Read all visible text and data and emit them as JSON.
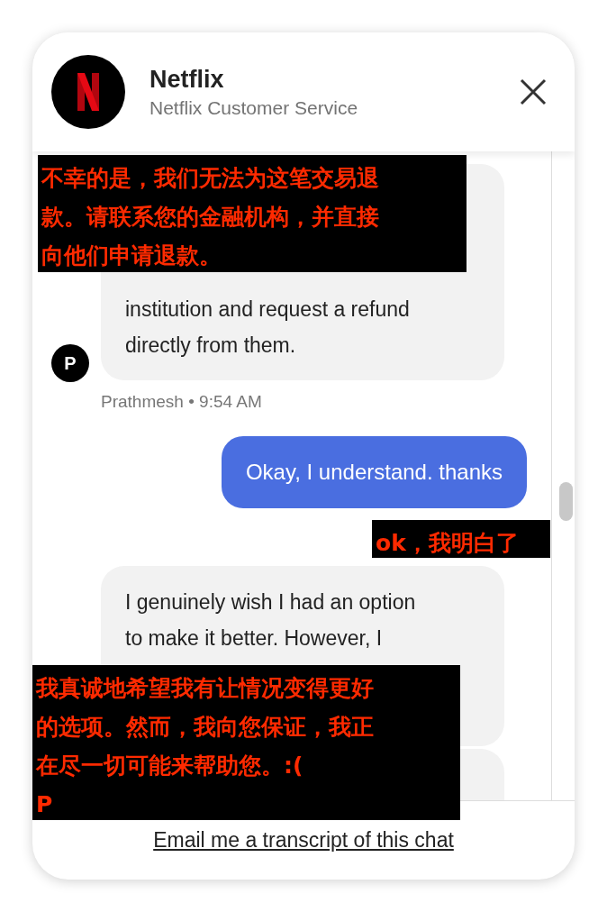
{
  "header": {
    "title": "Netflix",
    "subtitle": "Netflix Customer Service"
  },
  "messages": [
    {
      "kind": "agent",
      "lines": [
        "institution and request a refund",
        "directly from them."
      ],
      "avatar": "P",
      "meta": "Prathmesh • 9:54 AM"
    },
    {
      "kind": "user",
      "lines": [
        "Okay, I understand. thanks"
      ]
    },
    {
      "kind": "agent",
      "lines": [
        "I genuinely wish I had an option",
        "to make it better. However, I"
      ]
    },
    {
      "kind": "agent"
    }
  ],
  "translations": [
    {
      "lines": [
        "不幸的是，我们无法为这笔交易退",
        "款。请联系您的金融机构，并直接",
        "向他们申请退款。"
      ]
    },
    {
      "lines": [
        "ok，我明白了"
      ]
    },
    {
      "lines": [
        "我真诚地希望我有让情况变得更好",
        "的选项。然而，我向您保证，我正",
        "在尽一切可能来帮助您。:(",
        "P"
      ]
    }
  ],
  "footer": {
    "link": "Email me a transcript of this chat"
  }
}
